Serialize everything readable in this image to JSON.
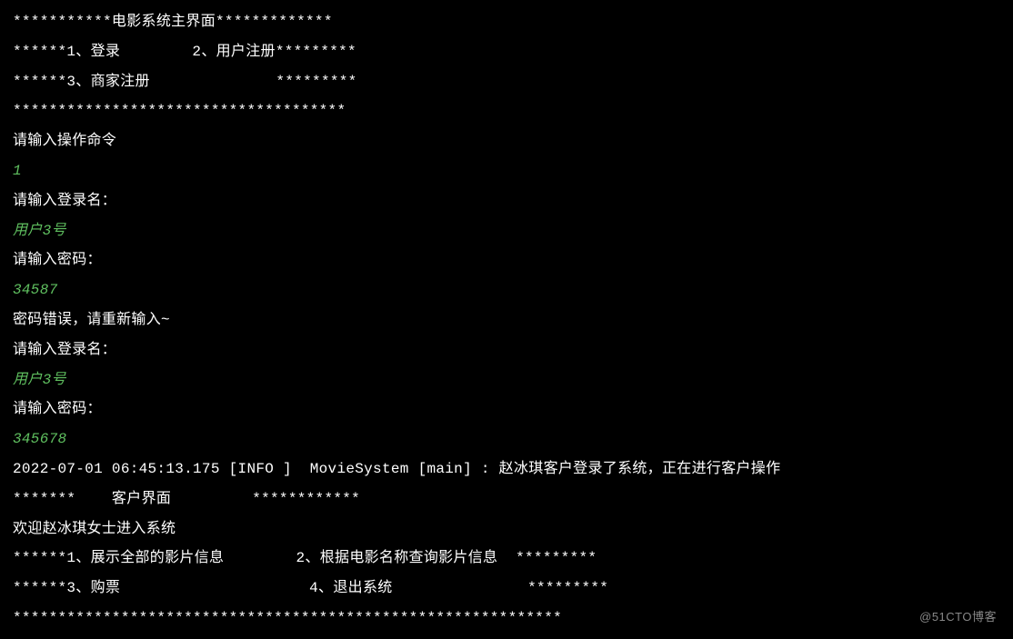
{
  "console": {
    "lines": [
      {
        "text": "***********电影系统主界面*************",
        "cls": ""
      },
      {
        "text": "******1、登录        2、用户注册*********",
        "cls": ""
      },
      {
        "text": "******3、商家注册              *********",
        "cls": ""
      },
      {
        "text": "*************************************",
        "cls": ""
      },
      {
        "text": "请输入操作命令",
        "cls": ""
      },
      {
        "text": "1",
        "cls": "input"
      },
      {
        "text": "请输入登录名：",
        "cls": ""
      },
      {
        "text": "用户3号",
        "cls": "input"
      },
      {
        "text": "请输入密码：",
        "cls": ""
      },
      {
        "text": "34587",
        "cls": "input"
      },
      {
        "text": "密码错误，请重新输入~",
        "cls": ""
      },
      {
        "text": "请输入登录名：",
        "cls": ""
      },
      {
        "text": "用户3号",
        "cls": "input"
      },
      {
        "text": "请输入密码：",
        "cls": ""
      },
      {
        "text": "345678",
        "cls": "input"
      },
      {
        "text": "2022-07-01 06:45:13.175 [INFO ]  MovieSystem [main] : 赵冰琪客户登录了系统，正在进行客户操作",
        "cls": ""
      },
      {
        "text": "*******    客户界面         ************",
        "cls": ""
      },
      {
        "text": "欢迎赵冰琪女士进入系统",
        "cls": ""
      },
      {
        "text": "******1、展示全部的影片信息        2、根据电影名称查询影片信息  *********",
        "cls": ""
      },
      {
        "text": "******3、购票                     4、退出系统               *********",
        "cls": ""
      },
      {
        "text": "*************************************************************",
        "cls": ""
      }
    ]
  },
  "watermark": "@51CTO博客"
}
